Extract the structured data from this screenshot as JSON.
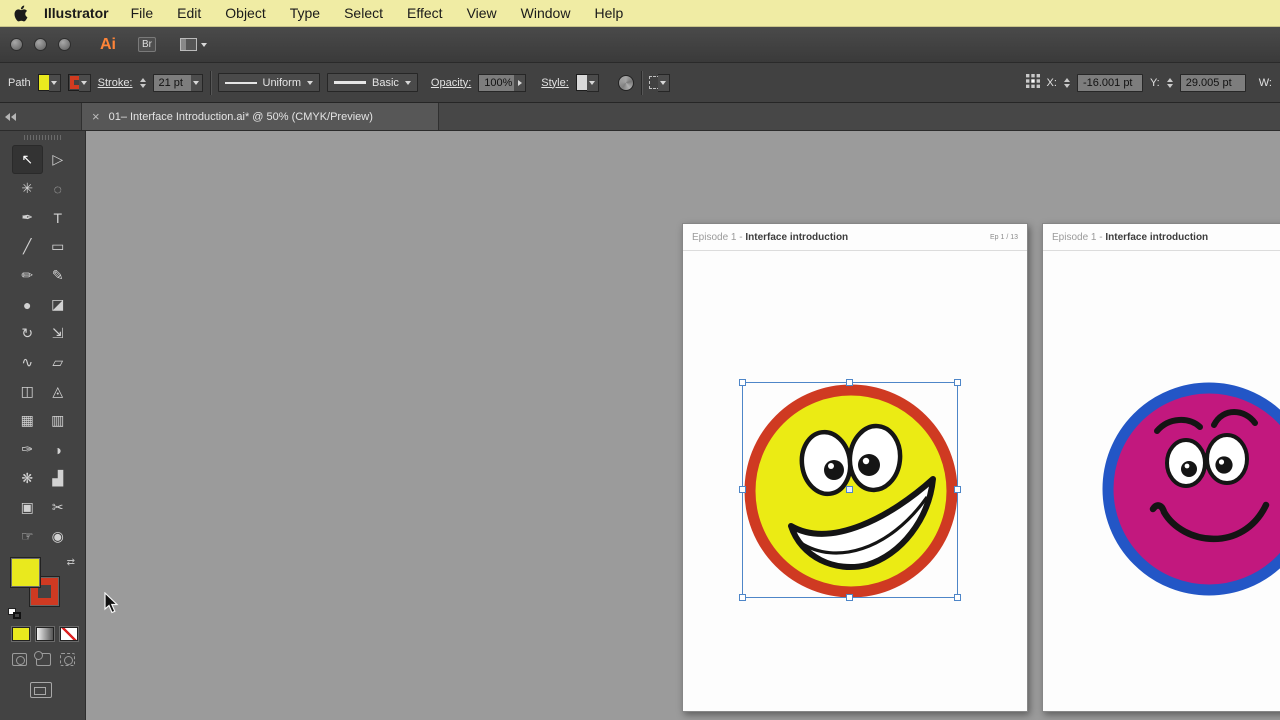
{
  "menu_bar": {
    "app_name": "Illustrator",
    "items": [
      "File",
      "Edit",
      "Object",
      "Type",
      "Select",
      "Effect",
      "View",
      "Window",
      "Help"
    ]
  },
  "app_bar": {
    "ai_badge": "Ai",
    "bridge_badge": "Br"
  },
  "control_panel": {
    "selection_label": "Path",
    "stroke_label": "Stroke:",
    "stroke_value": "21 pt",
    "width_profile": "Uniform",
    "brush_name": "Basic",
    "opacity_label": "Opacity:",
    "opacity_value": "100%",
    "style_label": "Style:",
    "x_label": "X:",
    "x_value": "-16.001 pt",
    "y_label": "Y:",
    "y_value": "29.005 pt",
    "w_label": "W:"
  },
  "tab_bar": {
    "close_glyph": "×",
    "title": "01– Interface Introduction.ai* @ 50% (CMYK/Preview)"
  },
  "toolbar": {
    "tools": [
      {
        "name": "selection-tool",
        "glyph": "↖"
      },
      {
        "name": "direct-selection-tool",
        "glyph": "▷"
      },
      {
        "name": "magic-wand-tool",
        "glyph": "✳"
      },
      {
        "name": "lasso-tool",
        "glyph": "◌"
      },
      {
        "name": "pen-tool",
        "glyph": "✒"
      },
      {
        "name": "type-tool",
        "glyph": "T"
      },
      {
        "name": "line-segment-tool",
        "glyph": "╱"
      },
      {
        "name": "rectangle-tool",
        "glyph": "▭"
      },
      {
        "name": "paintbrush-tool",
        "glyph": "✏"
      },
      {
        "name": "pencil-tool",
        "glyph": "✎"
      },
      {
        "name": "blob-brush-tool",
        "glyph": "●"
      },
      {
        "name": "eraser-tool",
        "glyph": "◪"
      },
      {
        "name": "rotate-tool",
        "glyph": "↻"
      },
      {
        "name": "scale-tool",
        "glyph": "⇲"
      },
      {
        "name": "width-tool",
        "glyph": "∿"
      },
      {
        "name": "free-transform-tool",
        "glyph": "▱"
      },
      {
        "name": "shape-builder-tool",
        "glyph": "◫"
      },
      {
        "name": "perspective-grid-tool",
        "glyph": "◬"
      },
      {
        "name": "mesh-tool",
        "glyph": "▦"
      },
      {
        "name": "gradient-tool",
        "glyph": "▥"
      },
      {
        "name": "eyedropper-tool",
        "glyph": "✑"
      },
      {
        "name": "blend-tool",
        "glyph": "◑"
      },
      {
        "name": "symbol-sprayer-tool",
        "glyph": "❋"
      },
      {
        "name": "column-graph-tool",
        "glyph": "▟"
      },
      {
        "name": "artboard-tool",
        "glyph": "▣"
      },
      {
        "name": "slice-tool",
        "glyph": "✂"
      },
      {
        "name": "hand-tool",
        "glyph": "☞"
      },
      {
        "name": "zoom-tool",
        "glyph": "◉"
      }
    ]
  },
  "artboard1": {
    "header_prefix": "Episode 1 - ",
    "header_title": "Interface introduction",
    "page_indicator": "Ep 1 / 13"
  },
  "artboard2": {
    "header_prefix": "Episode 1 - ",
    "header_title": "Interface introduction"
  },
  "colors": {
    "menu_bar_bg": "#f0eca4",
    "ai_orange": "#ff8438",
    "fill_swatch": "#e9e91e",
    "stroke_swatch": "#d03b20",
    "smiley1_fill": "#ebeb14",
    "smiley1_stroke": "#cf3a22",
    "smiley2_fill": "#c2187e",
    "smiley2_stroke": "#2356c6",
    "selection_blue": "#4e86c8",
    "canvas_bg": "#9b9b9b"
  }
}
